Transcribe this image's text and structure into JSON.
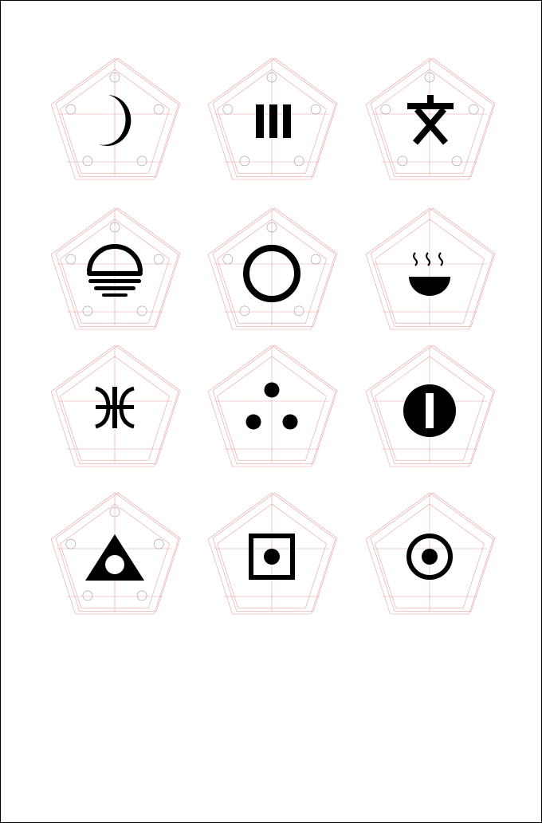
{
  "colors": {
    "guide": "#e8a0a0",
    "hole": "#a8a8a8",
    "symbol": "#000000",
    "background": "#ffffff",
    "border": "#000000"
  },
  "grid": {
    "rows": 4,
    "columns": 3,
    "tiles": [
      {
        "symbol": "crescent-moon-icon",
        "mounting_holes": true
      },
      {
        "symbol": "three-bars-icon",
        "mounting_holes": true
      },
      {
        "symbol": "wen-character-icon",
        "mounting_holes": true
      },
      {
        "symbol": "sunset-icon",
        "mounting_holes": true
      },
      {
        "symbol": "ring-icon",
        "mounting_holes": true
      },
      {
        "symbol": "steaming-bowl-icon",
        "mounting_holes": false
      },
      {
        "symbol": "tifinagh-yaz-icon",
        "mounting_holes": false
      },
      {
        "symbol": "three-dots-icon",
        "mounting_holes": false
      },
      {
        "symbol": "disc-with-bar-icon",
        "mounting_holes": false
      },
      {
        "symbol": "triangle-with-dot-icon",
        "mounting_holes": true
      },
      {
        "symbol": "square-with-dot-icon",
        "mounting_holes": false
      },
      {
        "symbol": "ring-with-dot-icon",
        "mounting_holes": false
      }
    ]
  }
}
